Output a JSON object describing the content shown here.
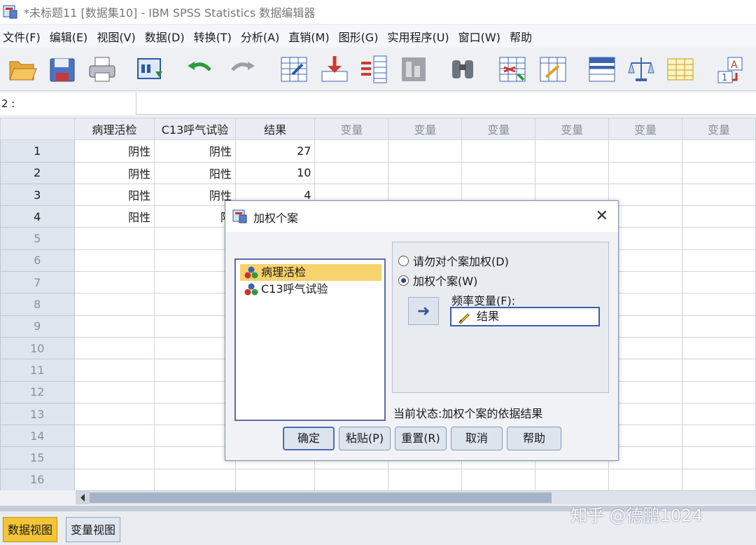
{
  "window": {
    "title": "*未标题11 [数据集10] - IBM SPSS Statistics 数据编辑器"
  },
  "menubar": [
    "文件(F)",
    "编辑(E)",
    "视图(V)",
    "数据(D)",
    "转换(T)",
    "分析(A)",
    "直销(M)",
    "图形(G)",
    "实用程序(U)",
    "窗口(W)",
    "帮助"
  ],
  "toolbar": {
    "icons": [
      "open-icon",
      "save-icon",
      "print-icon",
      "dialog-recall-icon",
      "undo-icon",
      "redo-icon",
      "goto-case-icon",
      "goto-variable-icon",
      "variables-icon",
      "run-descriptive-icon",
      "find-icon",
      "insert-cases-icon",
      "insert-variable-icon",
      "split-file-icon",
      "weight-cases-icon",
      "select-cases-icon",
      "value-labels-icon"
    ]
  },
  "cellbar": {
    "ref": "2 :"
  },
  "grid": {
    "columns": [
      "病理活检",
      "C13呼气试验",
      "结果",
      "变量",
      "变量",
      "变量",
      "变量",
      "变量",
      "变量"
    ],
    "rows": [
      [
        "1",
        "阴性",
        "阴性",
        "27"
      ],
      [
        "2",
        "阴性",
        "阳性",
        "10"
      ],
      [
        "3",
        "阳性",
        "阴性",
        "4"
      ],
      [
        "4",
        "阳性",
        "阳",
        ""
      ],
      [
        "5",
        "",
        "",
        ""
      ],
      [
        "6",
        "",
        "",
        ""
      ],
      [
        "7",
        "",
        "",
        ""
      ],
      [
        "8",
        "",
        "",
        ""
      ],
      [
        "9",
        "",
        "",
        ""
      ],
      [
        "10",
        "",
        "",
        ""
      ],
      [
        "11",
        "",
        "",
        ""
      ],
      [
        "12",
        "",
        "",
        ""
      ],
      [
        "13",
        "",
        "",
        ""
      ],
      [
        "14",
        "",
        "",
        ""
      ],
      [
        "15",
        "",
        "",
        ""
      ],
      [
        "16",
        "",
        "",
        ""
      ]
    ]
  },
  "tabs": {
    "data_view": "数据视图",
    "variable_view": "变量视图"
  },
  "watermark": "知乎 @德鹏1024",
  "dialog": {
    "title": "加权个案",
    "close": "✕",
    "variables": [
      "病理活检",
      "C13呼气试验"
    ],
    "selected_variable": "病理活检",
    "radio_no_weight": "请勿对个案加权(D)",
    "radio_weight": "加权个案(W)",
    "radio_selected": "weight",
    "freq_label": "频率变量(F):",
    "freq_value": "结果",
    "move_arrow": "➜",
    "status": "当前状态:加权个案的依据结果",
    "buttons": {
      "ok": "确定",
      "paste": "粘贴(P)",
      "reset": "重置(R)",
      "cancel": "取消",
      "help": "帮助"
    }
  },
  "colors": {
    "accent": "#f3c436",
    "selection": "#f6d36c",
    "header": "#e9edf3",
    "dialog_border": "#4a6cb0"
  }
}
